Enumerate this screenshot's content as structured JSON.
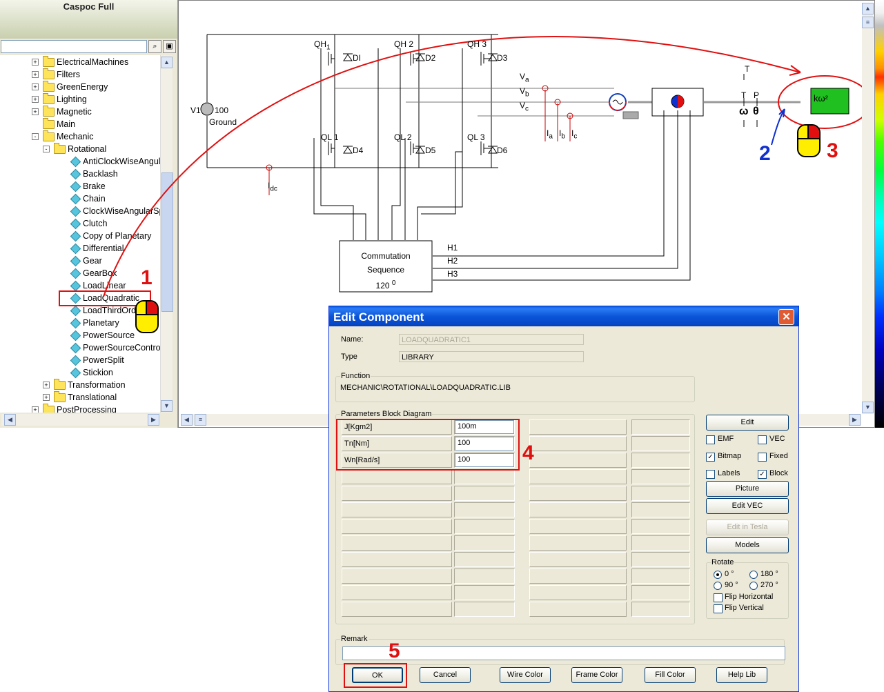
{
  "app": {
    "title": "Caspoc Full"
  },
  "tree": {
    "items": [
      {
        "label": "ElectricalMachines",
        "level": 1,
        "type": "folder",
        "expander": "+"
      },
      {
        "label": "Filters",
        "level": 1,
        "type": "folder",
        "expander": "+"
      },
      {
        "label": "GreenEnergy",
        "level": 1,
        "type": "folder",
        "expander": "+"
      },
      {
        "label": "Lighting",
        "level": 1,
        "type": "folder",
        "expander": "+"
      },
      {
        "label": "Magnetic",
        "level": 1,
        "type": "folder",
        "expander": "+"
      },
      {
        "label": "Main",
        "level": 1,
        "type": "folder",
        "expander": ""
      },
      {
        "label": "Mechanic",
        "level": 1,
        "type": "folder",
        "expander": "-"
      },
      {
        "label": "Rotational",
        "level": 2,
        "type": "folder",
        "expander": "-"
      },
      {
        "label": "AntiClockWiseAngularSpeed",
        "level": 3,
        "type": "leaf"
      },
      {
        "label": "Backlash",
        "level": 3,
        "type": "leaf"
      },
      {
        "label": "Brake",
        "level": 3,
        "type": "leaf"
      },
      {
        "label": "Chain",
        "level": 3,
        "type": "leaf"
      },
      {
        "label": "ClockWiseAngularSpeed",
        "level": 3,
        "type": "leaf"
      },
      {
        "label": "Clutch",
        "level": 3,
        "type": "leaf"
      },
      {
        "label": "Copy of Planetary",
        "level": 3,
        "type": "leaf"
      },
      {
        "label": "Differential",
        "level": 3,
        "type": "leaf"
      },
      {
        "label": "Gear",
        "level": 3,
        "type": "leaf"
      },
      {
        "label": "GearBox",
        "level": 3,
        "type": "leaf"
      },
      {
        "label": "LoadLinear",
        "level": 3,
        "type": "leaf"
      },
      {
        "label": "LoadQuadratic",
        "level": 3,
        "type": "leaf",
        "selected": true
      },
      {
        "label": "LoadThirdOrder",
        "level": 3,
        "type": "leaf"
      },
      {
        "label": "Planetary",
        "level": 3,
        "type": "leaf"
      },
      {
        "label": "PowerSource",
        "level": 3,
        "type": "leaf"
      },
      {
        "label": "PowerSourceControlled",
        "level": 3,
        "type": "leaf"
      },
      {
        "label": "PowerSplit",
        "level": 3,
        "type": "leaf"
      },
      {
        "label": "Stickion",
        "level": 3,
        "type": "leaf"
      },
      {
        "label": "Transformation",
        "level": 2,
        "type": "folder",
        "expander": "+"
      },
      {
        "label": "Translational",
        "level": 2,
        "type": "folder",
        "expander": "+"
      },
      {
        "label": "PostProcessing",
        "level": 1,
        "type": "folder",
        "expander": "+"
      }
    ]
  },
  "schematic": {
    "switches": [
      "QH1",
      "QH2",
      "QH3",
      "QL1",
      "QL2",
      "QL3"
    ],
    "switch_prefix_high": "QH",
    "switch_prefix_low": "QL",
    "diodes": [
      "DI",
      "D2",
      "D3",
      "D4",
      "D5",
      "D6"
    ],
    "source_label": "V1",
    "source_value": "100",
    "ground_label": "Ground",
    "phase_voltages": [
      "V",
      "a",
      "V",
      "b",
      "V",
      "c"
    ],
    "phase_currents": [
      "I",
      "a",
      "I",
      "b",
      "I",
      "c"
    ],
    "dc_current": [
      "I",
      "dc"
    ],
    "commutation_block": [
      "Commutation",
      "Sequence",
      "120",
      "0"
    ],
    "hall_signals": [
      "H1",
      "H2",
      "H3"
    ],
    "torque_labels": [
      "T",
      "T",
      "P"
    ],
    "speed_symbols": [
      "ω",
      "θ"
    ],
    "load_block_label": "kω²"
  },
  "dialog": {
    "title": "Edit Component",
    "close_glyph": "✕",
    "name_label": "Name:",
    "name_value": "LOADQUADRATIC1",
    "type_label": "Type",
    "type_value": "LIBRARY",
    "function_label": "Function",
    "function_value": "MECHANIC\\ROTATIONAL\\LOADQUADRATIC.LIB",
    "params_label": "Parameters Block Diagram",
    "params": [
      {
        "name": "J[Kgm2]",
        "value": "100m"
      },
      {
        "name": "Tn[Nm]",
        "value": "100"
      },
      {
        "name": "Wn[Rad/s]",
        "value": "100"
      }
    ],
    "side_buttons": {
      "edit": "Edit",
      "picture": "Picture",
      "edit_vec": "Edit VEC",
      "edit_tesla": "Edit in Tesla",
      "models": "Models"
    },
    "checkboxes": [
      {
        "label": "EMF",
        "checked": false
      },
      {
        "label": "VEC",
        "checked": false
      },
      {
        "label": "Bitmap",
        "checked": true
      },
      {
        "label": "Fixed",
        "checked": false
      },
      {
        "label": "Labels",
        "checked": false
      },
      {
        "label": "Block",
        "checked": true
      }
    ],
    "rotate": {
      "label": "Rotate",
      "options": [
        {
          "label": "0 °",
          "selected": true
        },
        {
          "label": "180 °",
          "selected": false
        },
        {
          "label": "90 °",
          "selected": false
        },
        {
          "label": "270 °",
          "selected": false
        }
      ],
      "flip_h": "Flip Horizontal",
      "flip_v": "Flip Vertical"
    },
    "remark_label": "Remark",
    "remark_value": "",
    "bottom_buttons": {
      "ok": "OK",
      "cancel": "Cancel",
      "wire_color": "Wire Color",
      "frame_color": "Frame Color",
      "fill_color": "Fill Color",
      "help_lib": "Help Lib"
    }
  },
  "annotations": {
    "steps": [
      "1",
      "2",
      "3",
      "4",
      "5"
    ]
  },
  "colors": {
    "annotation_red": "#e01010",
    "annotation_blue": "#1030d0",
    "mouse_yellow": "#ffee00",
    "load_green": "#20c020",
    "titlebar_blue": "#0b55d8"
  }
}
